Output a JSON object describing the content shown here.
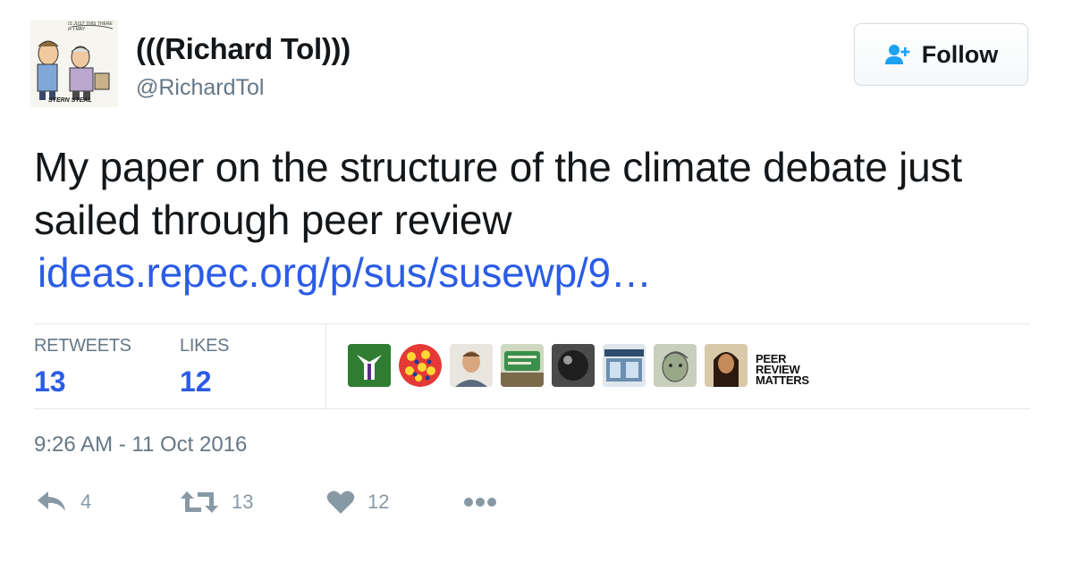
{
  "author": {
    "display_name": "(((Richard Tol)))",
    "handle": "@RichardTol",
    "avatar_caption": "STERN STEAL",
    "avatar_bubble": "IS JUST THIS THERE IF I MAY"
  },
  "follow_button": {
    "label": "Follow",
    "icon": "add-user-icon"
  },
  "tweet": {
    "text": "My paper on the structure of the climate debate just sailed through peer review",
    "link": "ideas.repec.org/p/sus/susewp/9…"
  },
  "stats": {
    "retweets_label": "RETWEETS",
    "retweets_value": "13",
    "likes_label": "LIKES",
    "likes_value": "12"
  },
  "likers": [
    {
      "name": "liker-avatar-1",
      "description": "green-white-figure",
      "color": "#2e7d32"
    },
    {
      "name": "liker-avatar-2",
      "description": "red-yellow-pattern",
      "color": "#e53935"
    },
    {
      "name": "liker-avatar-3",
      "description": "man-portrait",
      "color": "#c9a27a"
    },
    {
      "name": "liker-avatar-4",
      "description": "welcome-sign",
      "color": "#3a8f4c"
    },
    {
      "name": "liker-avatar-5",
      "description": "dark-round-object",
      "color": "#2b2b2b"
    },
    {
      "name": "liker-avatar-6",
      "description": "shop-front",
      "color": "#6b8fb0"
    },
    {
      "name": "liker-avatar-7",
      "description": "drawn-face",
      "color": "#9aa88a"
    },
    {
      "name": "liker-avatar-8",
      "description": "woman-portrait",
      "color": "#6d4c2f"
    },
    {
      "name": "liker-avatar-9",
      "description": "text-logo",
      "text": "PEER REVIEW MATTERS"
    }
  ],
  "timestamp": "9:26 AM - 11 Oct 2016",
  "actions": {
    "reply_count": "4",
    "retweet_count": "13",
    "like_count": "12"
  },
  "colors": {
    "link_blue": "#2b5ce6",
    "muted_gray": "#657786",
    "icon_gray": "#8899a6",
    "divider": "#e1e8ed"
  }
}
